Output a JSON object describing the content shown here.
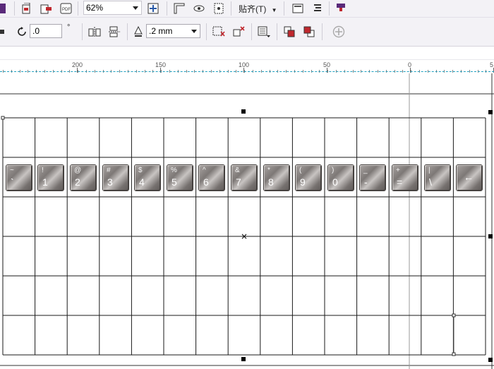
{
  "toolbar_top": {
    "zoom_value": "62%",
    "snap_menu_label": "贴齐(T)",
    "icons": [
      "pen-icon",
      "import-icon",
      "export-icon",
      "publish-pdf-icon",
      "zoom-dropdown",
      "full-screen-icon",
      "rulers-icon",
      "view-icon",
      "show-view-icon",
      "snap-menu",
      "options-icon",
      "align-icon",
      "launch-icon"
    ]
  },
  "toolbar_props": {
    "rotation_value": ".0",
    "rotation_unit": "°",
    "outline_width_value": ".2 mm"
  },
  "ruler": {
    "labels": [
      "200",
      "150",
      "100",
      "50",
      "0",
      "5"
    ]
  },
  "keyboard_keys": [
    {
      "shift": "~",
      "main": "`"
    },
    {
      "shift": "!",
      "main": "1"
    },
    {
      "shift": "@",
      "main": "2"
    },
    {
      "shift": "#",
      "main": "3"
    },
    {
      "shift": "$",
      "main": "4"
    },
    {
      "shift": "%",
      "main": "5"
    },
    {
      "shift": "^",
      "main": "6"
    },
    {
      "shift": "&",
      "main": "7"
    },
    {
      "shift": "*",
      "main": "8"
    },
    {
      "shift": "(",
      "main": "9"
    },
    {
      "shift": ")",
      "main": "0"
    },
    {
      "shift": "_",
      "main": "-"
    },
    {
      "shift": "+",
      "main": "="
    },
    {
      "shift": "|",
      "main": "\\"
    },
    {
      "shift": "",
      "main": "←"
    }
  ],
  "colors": {
    "toolbar_bg": "#f3f2f6",
    "grid_line": "#1a1a1a",
    "guide_blue": "#20a0c0",
    "key_gray": "#8a8583"
  }
}
